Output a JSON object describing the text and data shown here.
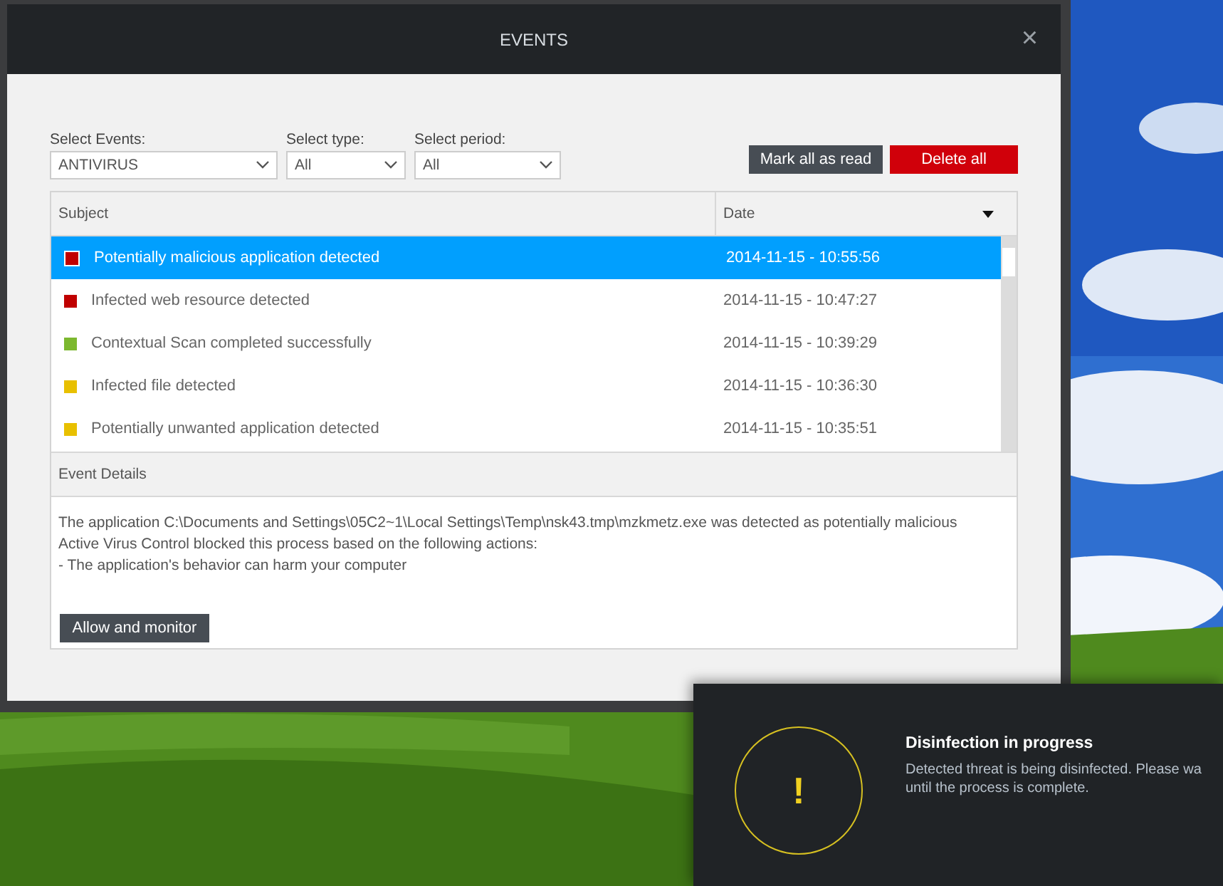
{
  "window": {
    "title": "EVENTS",
    "close": "×"
  },
  "filters": [
    {
      "label": "Select Events:",
      "value": "ANTIVIRUS"
    },
    {
      "label": "Select type:",
      "value": "All"
    },
    {
      "label": "Select period:",
      "value": "All"
    }
  ],
  "actions": [
    {
      "label": "Mark all as read",
      "kind": "neutral"
    },
    {
      "label": "Delete all",
      "kind": "danger"
    }
  ],
  "table": {
    "columns": [
      "Subject",
      "Date"
    ],
    "rows": [
      {
        "subject": "Potentially malicious application detected",
        "date": "2014-11-15 - 10:55:56",
        "color": "#c00000",
        "selected": true
      },
      {
        "subject": "Infected web resource detected",
        "date": "2014-11-15 - 10:47:27",
        "color": "#c00000",
        "selected": false
      },
      {
        "subject": "Contextual Scan completed successfully",
        "date": "2014-11-15 - 10:39:29",
        "color": "#7cb82f",
        "selected": false
      },
      {
        "subject": "Infected file detected",
        "date": "2014-11-15 - 10:36:30",
        "color": "#e8c000",
        "selected": false
      },
      {
        "subject": "Potentially unwanted application detected",
        "date": "2014-11-15 - 10:35:51",
        "color": "#e8c000",
        "selected": false
      }
    ]
  },
  "details": {
    "title": "Event Details",
    "lines": [
      "The application C:\\Documents and Settings\\05C2~1\\Local Settings\\Temp\\nsk43.tmp\\mzkmetz.exe was detected as potentially malicious",
      "Active Virus Control blocked this process based on the following actions:",
      "- The application's behavior can harm your computer"
    ],
    "button": "Allow and monitor"
  },
  "notification": {
    "icon": "!",
    "title": "Disinfection in progress",
    "lines": [
      "Detected threat is being disinfected. Please wa",
      "until the process is complete."
    ]
  }
}
